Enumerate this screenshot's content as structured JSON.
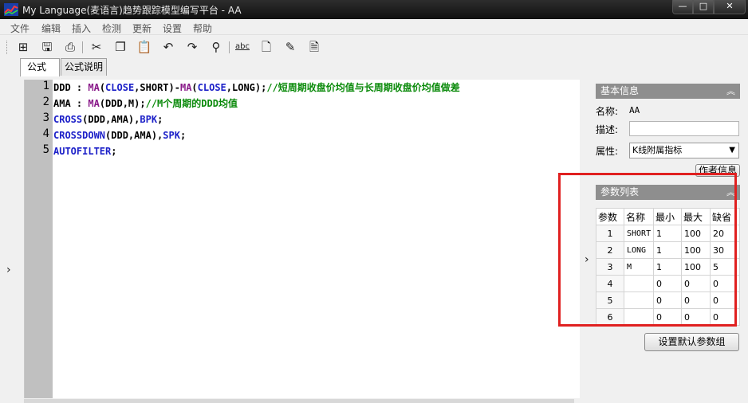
{
  "window": {
    "title": "My Language(麦语言)趋势跟踪模型编写平台 - AA",
    "minimize_glyph": "—",
    "maximize_glyph": "□",
    "close_glyph": "✕"
  },
  "menu": [
    "文件",
    "编辑",
    "插入",
    "检测",
    "更新",
    "设置",
    "帮助"
  ],
  "toolbar": {
    "new_glyph": "⊞",
    "save_glyph": "🖫",
    "print_glyph": "⎙",
    "cut_glyph": "✂",
    "copy_glyph": "❐",
    "paste_glyph": "📋",
    "undo_glyph": "↶",
    "redo_glyph": "↷",
    "find_glyph": "⚲",
    "spell_glyph": "abc",
    "doc_glyph": "🗋",
    "tool_glyph": "✎",
    "page_glyph": "🗎"
  },
  "tabs": [
    "公式",
    "公式说明"
  ],
  "editor": {
    "line_numbers": [
      "1",
      "2",
      "3",
      "4",
      "5"
    ],
    "lines": [
      [
        {
          "t": "DDD : ",
          "c": ""
        },
        {
          "t": "MA",
          "c": "fn"
        },
        {
          "t": "(",
          "c": ""
        },
        {
          "t": "CLOSE",
          "c": "kw"
        },
        {
          "t": ",SHORT)-",
          "c": ""
        },
        {
          "t": "MA",
          "c": "fn"
        },
        {
          "t": "(",
          "c": ""
        },
        {
          "t": "CLOSE",
          "c": "kw"
        },
        {
          "t": ",LONG);",
          "c": ""
        },
        {
          "t": "//短周期收盘价均值与长周期收盘价均值做差",
          "c": "cmt"
        }
      ],
      [
        {
          "t": "AMA : ",
          "c": ""
        },
        {
          "t": "MA",
          "c": "fn"
        },
        {
          "t": "(DDD,M);",
          "c": ""
        },
        {
          "t": "//M个周期的DDD均值",
          "c": "cmt"
        }
      ],
      [
        {
          "t": "CROSS",
          "c": "kw"
        },
        {
          "t": "(DDD,AMA),",
          "c": ""
        },
        {
          "t": "BPK",
          "c": "kw"
        },
        {
          "t": ";",
          "c": ""
        }
      ],
      [
        {
          "t": "CROSSDOWN",
          "c": "kw"
        },
        {
          "t": "(DDD,AMA),",
          "c": ""
        },
        {
          "t": "SPK",
          "c": "kw"
        },
        {
          "t": ";",
          "c": ""
        }
      ],
      [
        {
          "t": "AUTOFILTER",
          "c": "kw"
        },
        {
          "t": ";",
          "c": ""
        }
      ]
    ]
  },
  "collapse_arrow": "›",
  "basic_info": {
    "header": "基本信息",
    "collapse_glyph": "︽",
    "name_label": "名称:",
    "name_value": "AA",
    "desc_label": "描述:",
    "desc_value": "",
    "attr_label": "属性:",
    "attr_value": "K线附属指标",
    "dropdown_glyph": "▼",
    "author_button": "作者信息"
  },
  "params": {
    "header": "参数列表",
    "collapse_glyph": "︽",
    "columns": [
      "参数",
      "名称",
      "最小",
      "最大",
      "缺省"
    ],
    "rows": [
      [
        "1",
        "SHORT",
        "1",
        "100",
        "20"
      ],
      [
        "2",
        "LONG",
        "1",
        "100",
        "30"
      ],
      [
        "3",
        "M",
        "1",
        "100",
        "5"
      ],
      [
        "4",
        "",
        "0",
        "0",
        "0"
      ],
      [
        "5",
        "",
        "0",
        "0",
        "0"
      ],
      [
        "6",
        "",
        "0",
        "0",
        "0"
      ]
    ],
    "default_button": "设置默认参数组"
  },
  "colors": {
    "keyword": "#1c20c8",
    "function": "#8a1a8a",
    "comment": "#0a8a0a",
    "highlight": "#e02020"
  }
}
